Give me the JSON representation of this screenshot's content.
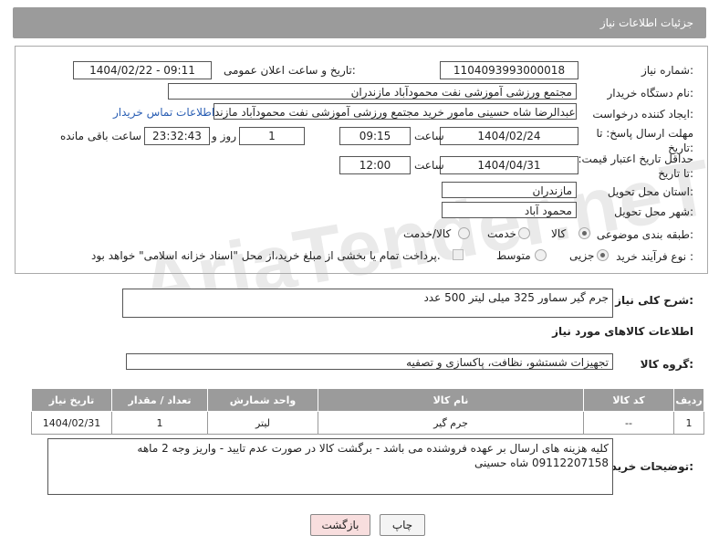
{
  "header": {
    "title": "جزئیات اطلاعات نیاز"
  },
  "form": {
    "need_number_label": "شماره نیاز:",
    "need_number": "1104093993000018",
    "announce_label": "تاریخ و ساعت اعلان عمومی:",
    "announce_value": "1404/02/22 - 09:11",
    "buyer_org_label": "نام دستگاه خریدار:",
    "buyer_org": "مجتمع ورزشی آموزشی نفت محمودآباد مازندران",
    "creator_label": "ایجاد کننده درخواست:",
    "creator": "عبدالرضا شاه حسینی مامور خرید مجتمع ورزشی آموزشی نفت محمودآباد مازند",
    "contact_link": "اطلاعات تماس خریدار",
    "reply_deadline_label": "مهلت ارسال پاسخ: تا تاریخ:",
    "reply_date": "1404/02/24",
    "hour_label": "ساعت",
    "reply_hour": "09:15",
    "days_value": "1",
    "days_label": "روز و",
    "remaining_time": "23:32:43",
    "remaining_label": "ساعت باقی مانده",
    "price_validity_label": "حداقل تاریخ اعتبار قیمت: تا تاریخ:",
    "price_date": "1404/04/31",
    "price_hour": "12:00",
    "province_label": "استان محل تحویل:",
    "province": "مازندران",
    "city_label": "شهر محل تحویل:",
    "city": "محمود آباد",
    "category_label": "طبقه بندی موضوعی:",
    "category_options": [
      "کالا",
      "خدمت",
      "کالا/خدمت"
    ],
    "process_label": "نوع فرآیند خرید :",
    "process_options": [
      "جزیی",
      "متوسط"
    ],
    "payment_note": "پرداخت تمام یا بخشی از مبلغ خرید،از محل \"اسناد خزانه اسلامی\" خواهد بود."
  },
  "watermark": "AriaTender.neT",
  "description": {
    "label": "شرح کلی نیاز:",
    "value": "جرم گیر سماور 325 میلی لیتر   500 عدد"
  },
  "goods_info_title": "اطلاعات کالاهای مورد نیاز",
  "goods_group": {
    "label": "گروه کالا:",
    "value": "تجهیزات شستشو، نظافت، پاکسازی و تصفیه"
  },
  "table": {
    "headers": [
      "ردیف",
      "کد کالا",
      "نام کالا",
      "واحد شمارش",
      "تعداد / مقدار",
      "تاریخ نیاز"
    ],
    "rows": [
      [
        "1",
        "--",
        "جرم گیر",
        "لیتر",
        "1",
        "1404/02/31"
      ]
    ]
  },
  "buyer_notes": {
    "label": "توضیحات خریدار:",
    "line1": "کلیه هزینه های ارسال بر عهده فروشنده می باشد - برگشت کالا در صورت عدم تایید - واریز وجه 2 ماهه",
    "line2": "09112207158 شاه حسینی"
  },
  "buttons": {
    "print": "چاپ",
    "back": "بازگشت"
  }
}
